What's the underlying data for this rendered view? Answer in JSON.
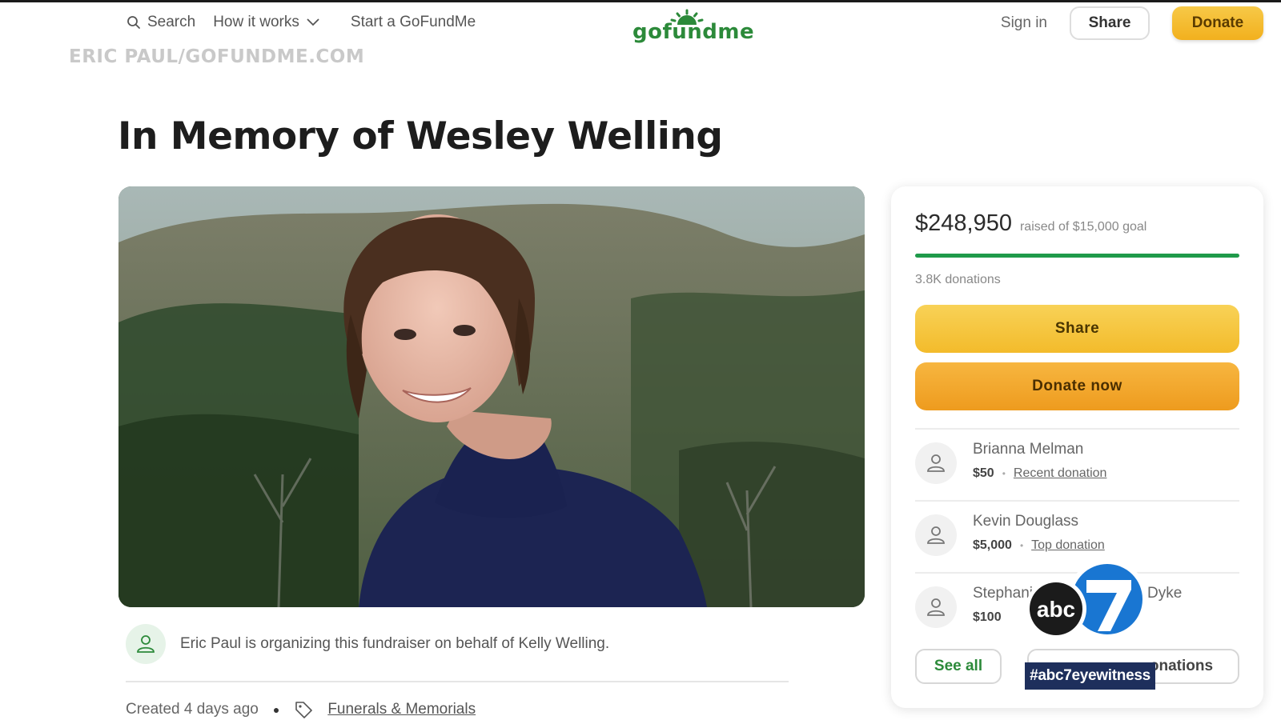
{
  "header": {
    "search_label": "Search",
    "how_it_works_label": "How it works",
    "start_label": "Start a GoFundMe",
    "logo_text": "gofundme",
    "signin_label": "Sign in",
    "share_label": "Share",
    "donate_label": "Donate"
  },
  "watermark": "ERIC PAUL/GOFUNDME.COM",
  "campaign": {
    "title": "In Memory of Wesley Welling",
    "organizer_text": "Eric Paul is organizing this fundraiser on behalf of Kelly Welling.",
    "created_text": "Created 4 days ago",
    "category": "Funerals & Memorials"
  },
  "sidebar": {
    "raised_amount": "$248,950",
    "raised_goal_text": "raised of $15,000 goal",
    "progress_fraction": 1.0,
    "donations_count": "3.8K donations",
    "share_label": "Share",
    "donate_now_label": "Donate now",
    "donors": [
      {
        "name": "Brianna Melman",
        "amount": "$50",
        "tag": "Recent donation"
      },
      {
        "name": "Kevin Douglass",
        "amount": "$5,000",
        "tag": "Top donation"
      },
      {
        "name": "Stephanie",
        "name_suffix": "Dyke",
        "amount": "$100",
        "tag": ""
      }
    ],
    "see_all_label": "See all",
    "top_donations_label": "onations"
  },
  "overlay": {
    "logo_text": "abc",
    "channel_number": "7",
    "hashtag": "#abc7eyewitness"
  },
  "colors": {
    "brand_green": "#2c8a3a",
    "progress_green": "#1f9a4a",
    "donate_orange": "#f2b01e",
    "abc_blue": "#1e2f5c"
  }
}
